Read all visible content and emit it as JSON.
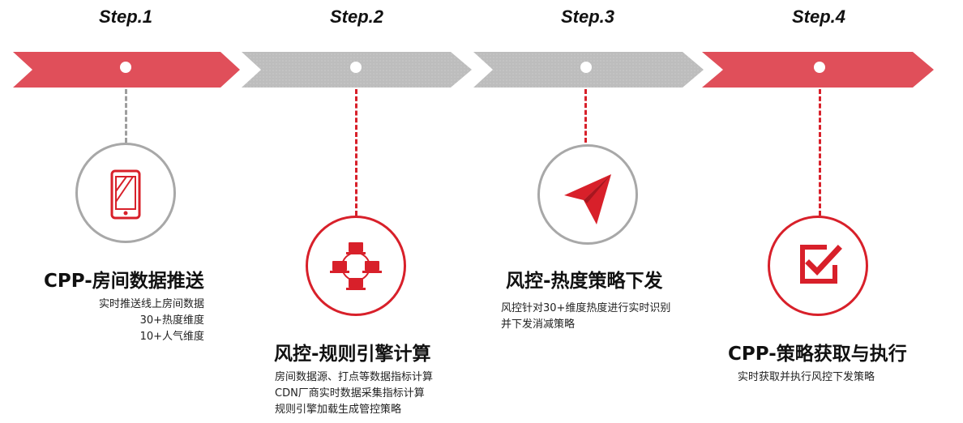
{
  "colors": {
    "accent": "#e04f5a",
    "accent_dark": "#d8202a",
    "inactive": "#bdbdbd",
    "line_gray": "#9e9e9e"
  },
  "steps": [
    {
      "label": "Step.1",
      "state": "active",
      "icon": "smartphone-icon",
      "title": "CPP-房间数据推送",
      "desc": [
        "实时推送线上房间数据",
        "30+热度维度",
        "10+人气维度"
      ]
    },
    {
      "label": "Step.2",
      "state": "inactive",
      "icon": "network-computers-icon",
      "title": "风控-规则引擎计算",
      "desc": [
        "房间数据源、打点等数据指标计算",
        "CDN厂商实时数据采集指标计算",
        "规则引擎加载生成管控策略"
      ]
    },
    {
      "label": "Step.3",
      "state": "inactive",
      "icon": "paper-plane-icon",
      "title": "风控-热度策略下发",
      "desc": [
        "风控针对30+维度热度进行实时识别",
        "并下发消减策略"
      ]
    },
    {
      "label": "Step.4",
      "state": "active",
      "icon": "checkbox-icon",
      "title": "CPP-策略获取与执行",
      "desc": [
        "实时获取并执行风控下发策略"
      ]
    }
  ]
}
